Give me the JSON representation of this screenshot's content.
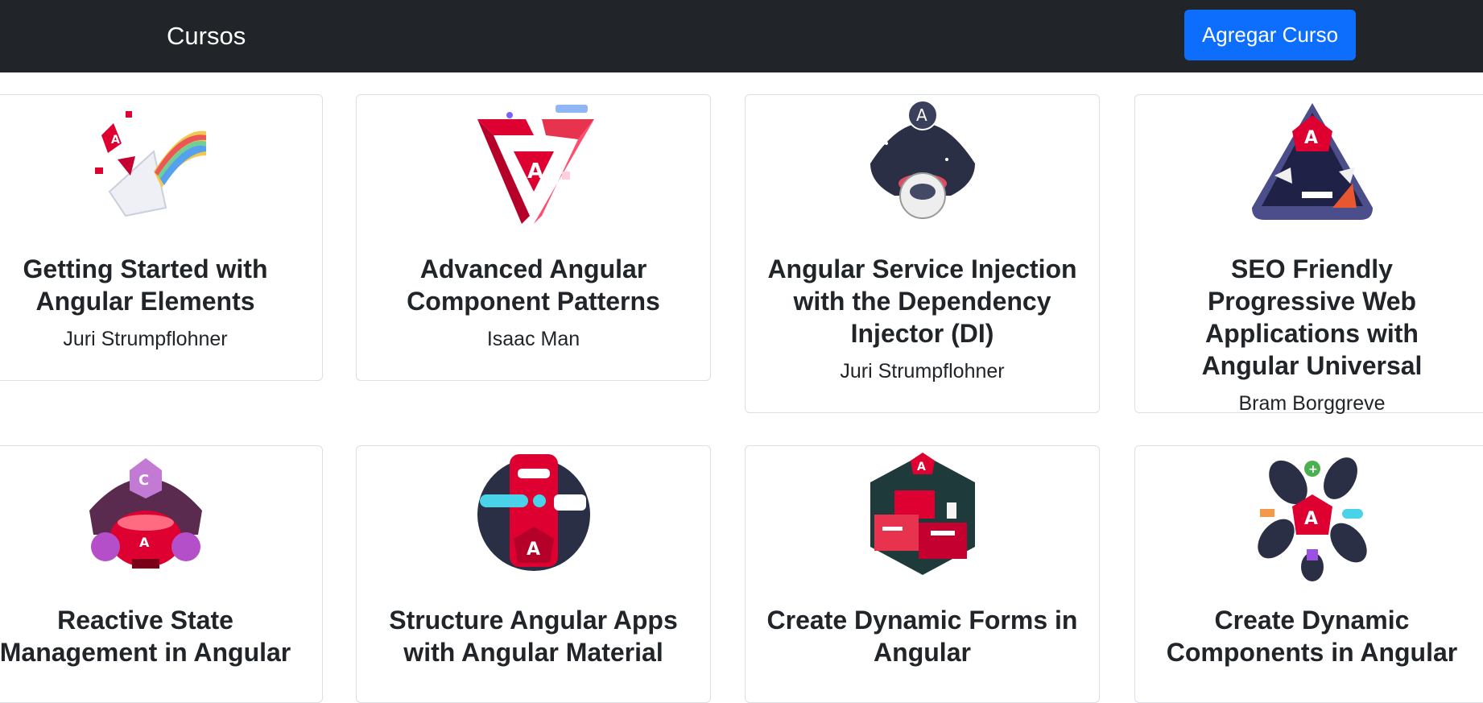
{
  "navbar": {
    "brand": "Cursos",
    "add_button_label": "Agregar Curso"
  },
  "courses": [
    {
      "title": "Getting Started with Angular Elements",
      "author": "Juri Strumpflohner"
    },
    {
      "title": "Advanced Angular Component Patterns",
      "author": "Isaac Man"
    },
    {
      "title": "Angular Service Injection with the Dependency Injector (DI)",
      "author": "Juri Strumpflohner"
    },
    {
      "title": "SEO Friendly Progressive Web Applications with Angular Universal",
      "author": "Bram Borggreve"
    },
    {
      "title": "Reactive State Management in Angular"
    },
    {
      "title": "Structure Angular Apps with Angular Material"
    },
    {
      "title": "Create Dynamic Forms in Angular"
    },
    {
      "title": "Create Dynamic Components in Angular"
    }
  ],
  "colors": {
    "navbar_bg": "#212529",
    "primary": "#0d6efd",
    "angular_red": "#dd0031"
  }
}
